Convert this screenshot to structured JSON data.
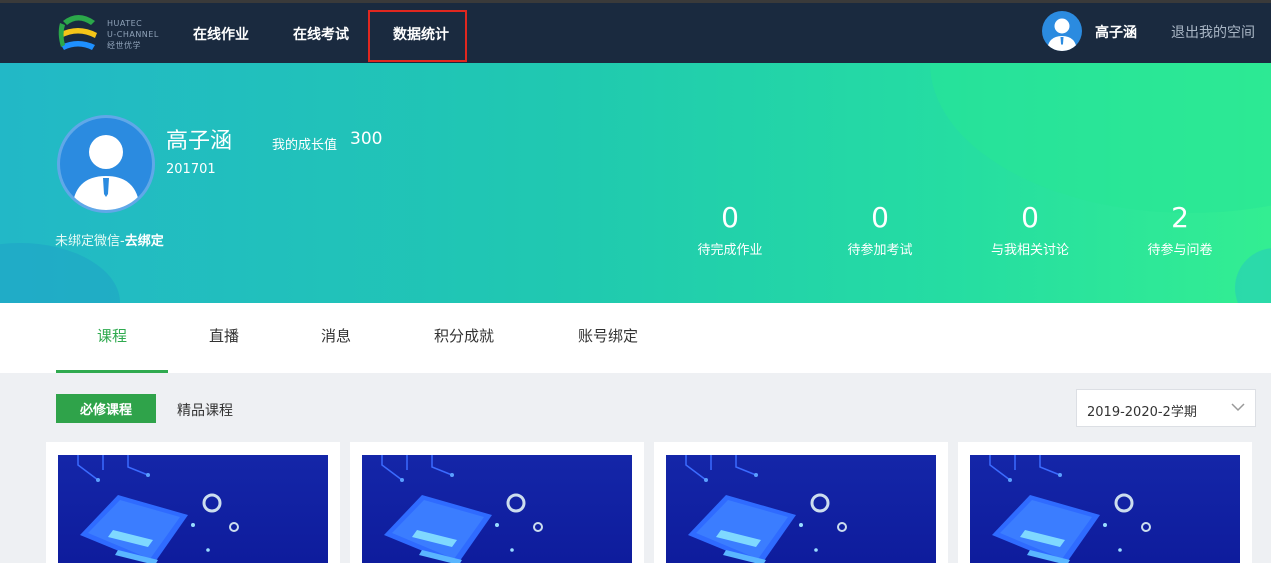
{
  "brand": {
    "line1": "HUATEC",
    "line2": "U-CHANNEL",
    "line3": "经世优学",
    "colors": [
      "#2ba84a",
      "#f5c518",
      "#1e90ff"
    ]
  },
  "nav": {
    "items": [
      {
        "label": "在线作业"
      },
      {
        "label": "在线考试"
      },
      {
        "label": "数据统计",
        "highlighted": true
      }
    ]
  },
  "user": {
    "name": "高子涵",
    "logout": "退出我的空间"
  },
  "profile": {
    "name": "高子涵",
    "growth_label": "我的成长值",
    "growth_value": "300",
    "student_id": "201701",
    "wechat_text": "未绑定微信-",
    "wechat_link": "去绑定"
  },
  "stats": [
    {
      "value": "0",
      "label": "待完成作业"
    },
    {
      "value": "0",
      "label": "待参加考试"
    },
    {
      "value": "0",
      "label": "与我相关讨论"
    },
    {
      "value": "2",
      "label": "待参与问卷"
    }
  ],
  "tabs": [
    {
      "label": "课程",
      "active": true
    },
    {
      "label": "直播"
    },
    {
      "label": "消息"
    },
    {
      "label": "积分成就"
    },
    {
      "label": "账号绑定"
    }
  ],
  "filters": {
    "required": "必修课程",
    "premium": "精品课程",
    "term": "2019-2020-2学期"
  },
  "colors": {
    "nav_bg": "#1a2a3f",
    "accent_green": "#2fa34a",
    "highlight_red": "#e0271f"
  }
}
